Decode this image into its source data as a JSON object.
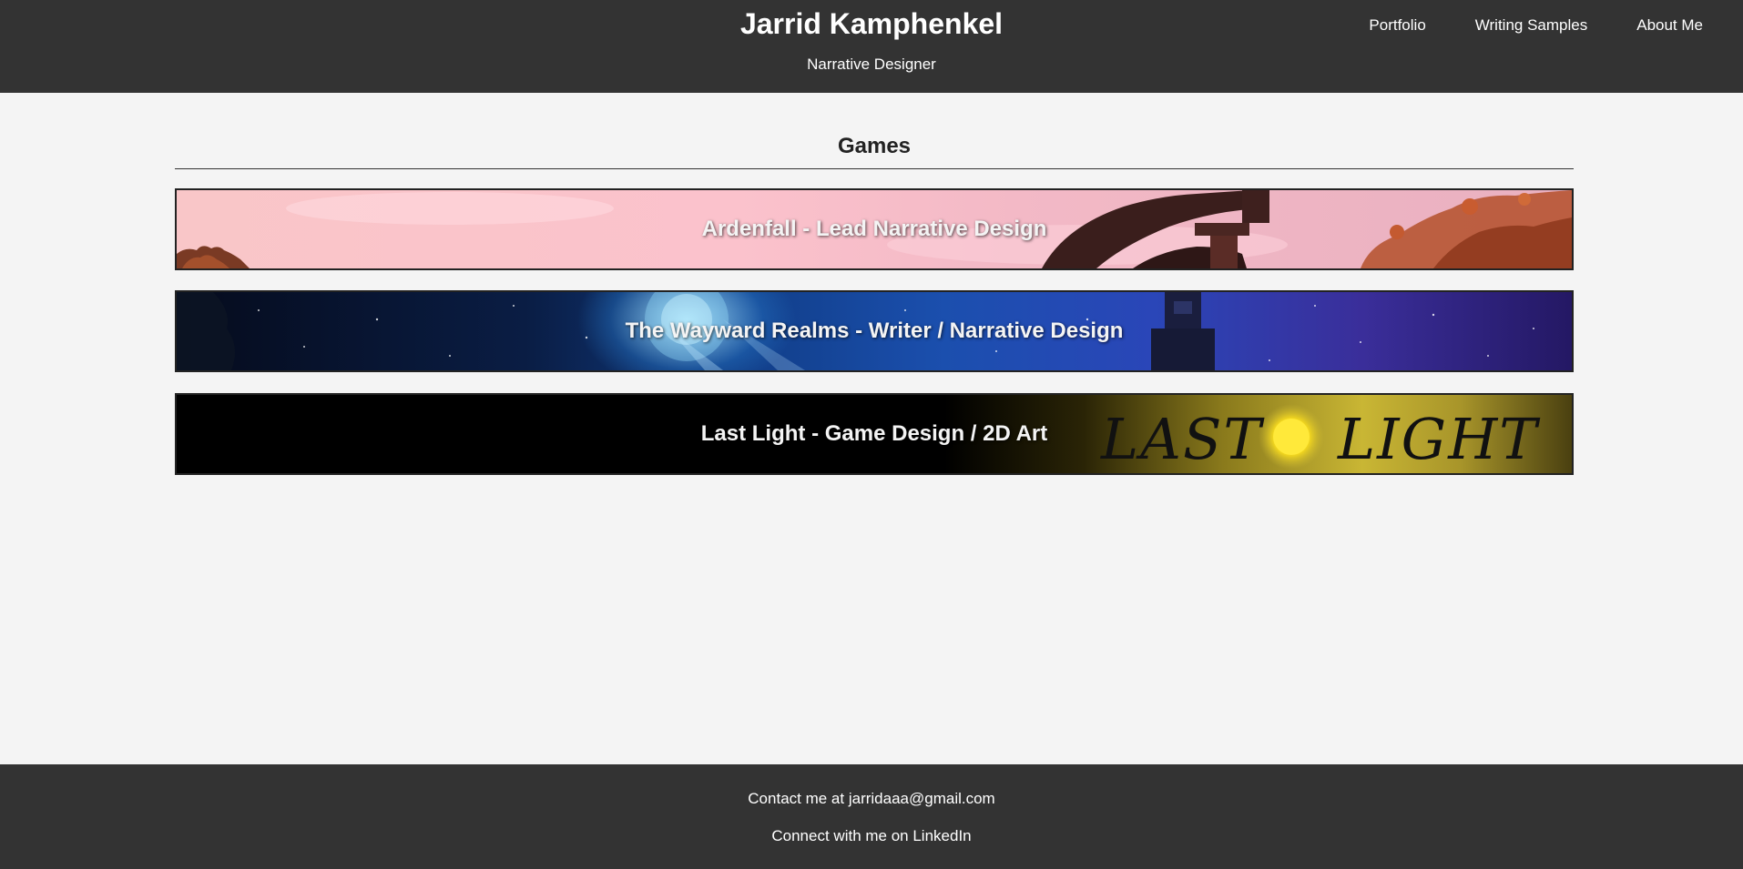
{
  "header": {
    "title": "Jarrid Kamphenkel",
    "subtitle": "Narrative Designer",
    "nav": [
      {
        "label": "Portfolio"
      },
      {
        "label": "Writing Samples"
      },
      {
        "label": "About Me"
      }
    ]
  },
  "main": {
    "section_title": "Games",
    "games": [
      {
        "label": "Ardenfall - Lead Narrative Design"
      },
      {
        "label": "The Wayward Realms - Writer / Narrative Design"
      },
      {
        "label": "Last Light - Game Design / 2D Art"
      }
    ],
    "banner_text_lastlight": "LAST LIGHT"
  },
  "footer": {
    "contact_prefix": "Contact me at ",
    "email": "jarridaaa@gmail.com",
    "linkedin_prefix": "Connect with me on ",
    "linkedin_label": "LinkedIn"
  },
  "colors": {
    "header_bg": "#333333",
    "page_bg": "#f4f4f4",
    "footer_bg": "#333333",
    "text_on_dark": "#ffffff"
  }
}
